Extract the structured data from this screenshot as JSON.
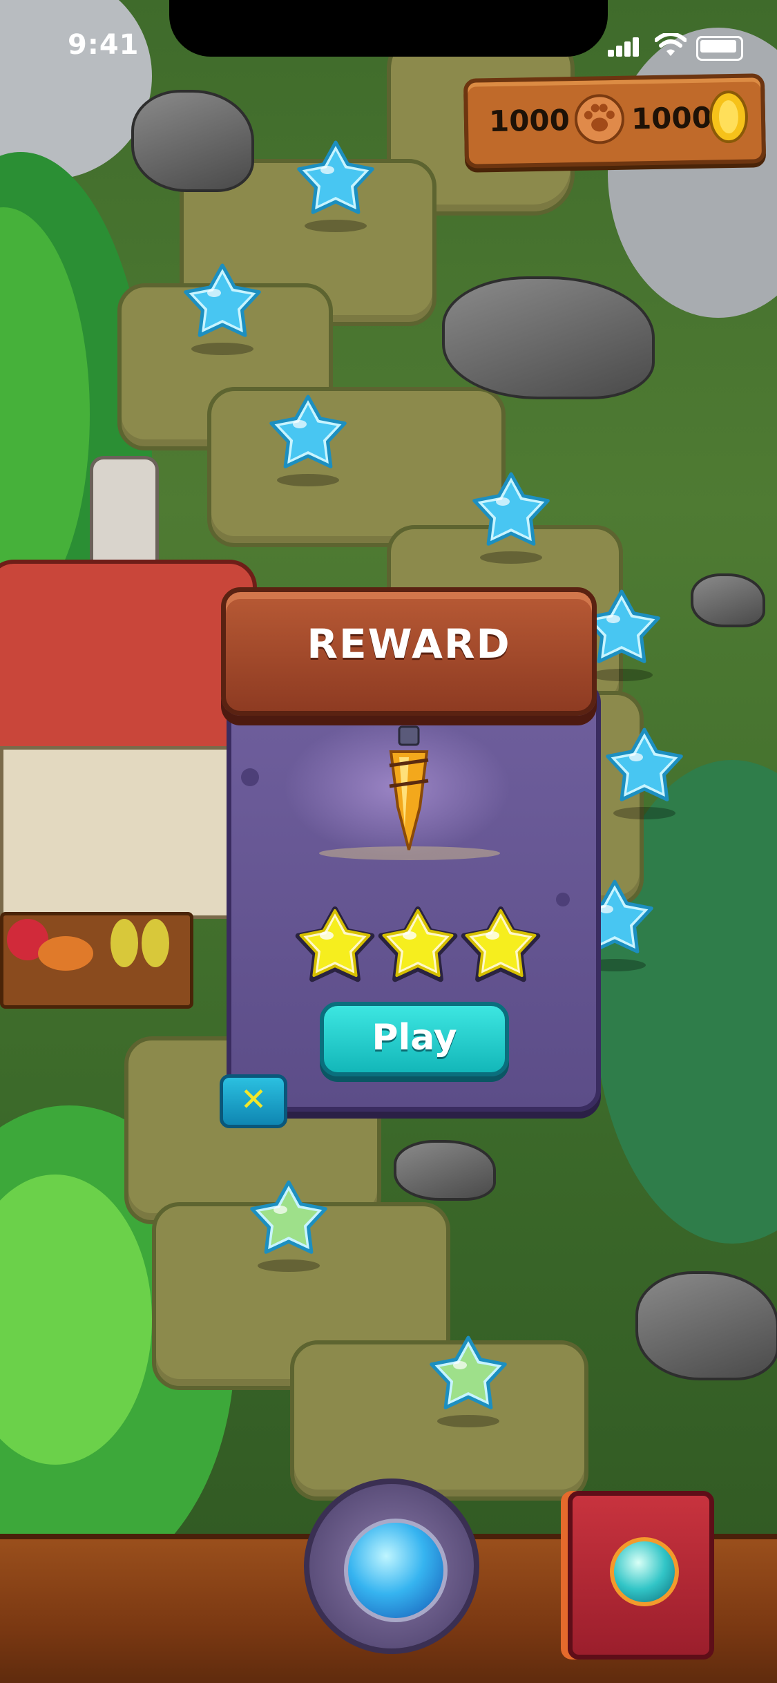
{
  "status_bar": {
    "time": "9:41"
  },
  "currency": {
    "paws": "1000",
    "coins": "1000"
  },
  "reward_modal": {
    "title": "REWARD",
    "stars_earned": 3,
    "stars_total": 3,
    "play_label": "Play",
    "close_glyph": "✕"
  },
  "map": {
    "level_nodes": [
      {
        "state": "locked"
      },
      {
        "state": "locked"
      },
      {
        "state": "locked"
      },
      {
        "state": "locked"
      },
      {
        "state": "locked"
      },
      {
        "state": "locked"
      },
      {
        "state": "locked"
      },
      {
        "state": "unlocked"
      },
      {
        "state": "unlocked"
      }
    ]
  },
  "icons": {
    "paw": "paw-icon",
    "coin": "coin-icon",
    "reward_item": "amber-crystal-icon",
    "portal": "portal-button",
    "book": "spellbook-button"
  },
  "colors": {
    "locked_star": "#48c6f2",
    "unlocked_star": "#9ee08a",
    "earned_star": "#f6ee1e",
    "play_button": "#1fc8c8",
    "banner": "#a8492a",
    "panel": "#66569a"
  }
}
